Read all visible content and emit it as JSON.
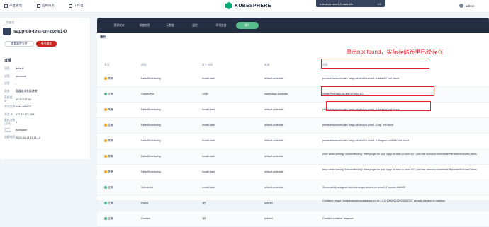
{
  "topbar": {
    "nav": [
      {
        "label": "平台管理",
        "icon": "grid-icon"
      },
      {
        "label": "应用商店",
        "icon": "store-icon"
      },
      {
        "label": "工作台",
        "icon": "workbench-icon"
      }
    ],
    "brand": "KUBESPHERE",
    "popup_title": "b-test-cn-zone1-0-data-file",
    "popup_counter": "1/2",
    "user": "admin"
  },
  "sidebar": {
    "back_label": "容器组",
    "pod_name": "sapp-ob-test-cn-zone1-0",
    "yaml_button": "查看配置文件",
    "more_button": "更多操作",
    "details_title": "详情",
    "details": [
      {
        "key": "项目",
        "value": "default"
      },
      {
        "key": "应用",
        "value": "obcluster"
      },
      {
        "key": "应用",
        "value": "-"
      },
      {
        "key": "状态",
        "value": "容器组未准备就绪"
      },
      {
        "key": "容器组 IP",
        "value": "10.50.112.30"
      },
      {
        "key": "节点名称",
        "value": "ndev-k8s003"
      },
      {
        "key": "节点 IP",
        "value": "172.19.121.198"
      },
      {
        "key": "重启次数(总计)",
        "value": "0"
      },
      {
        "key": "QoS Class",
        "value": "Burstable"
      },
      {
        "key": "创建时间",
        "value": "2023-04-14 16:11:14"
      }
    ]
  },
  "tabs": [
    "资源状态",
    "调度信息",
    "元数据",
    "监控",
    "环境变量",
    "事件"
  ],
  "active_tab": 5,
  "events": {
    "title": "事件",
    "headers": {
      "type": "类型",
      "reason": "原因",
      "time": "发生时间",
      "source": "来源",
      "message": "消息"
    },
    "annotation": "显示not found，实际存储卷里已经存在",
    "rows": [
      {
        "type": "异常",
        "reason": "FailedScheduling",
        "time": "Invalid date",
        "source": "default-scheduler",
        "message": "persistentvolumeclaim \"sapp-ob-test-cn-zone1-0-data-file\" not found"
      },
      {
        "type": "正常",
        "reason": "CreatedPod",
        "time": "1分钟",
        "source": "statefulapp-controller",
        "message": "create Pod sapp-ob-test-cn-zone1-0"
      },
      {
        "type": "异常",
        "reason": "FailedScheduling",
        "time": "Invalid date",
        "source": "default-scheduler",
        "message": "persistentvolumeclaim \"sapp-ob-test-cn-zone1-0-data-log\" not found"
      },
      {
        "type": "异常",
        "reason": "FailedScheduling",
        "time": "Invalid date",
        "source": "default-scheduler",
        "message": "persistentvolumeclaim \"sapp-ob-test-cn-zone1-0-log\" not found"
      },
      {
        "type": "异常",
        "reason": "FailedScheduling",
        "time": "Invalid date",
        "source": "default-scheduler",
        "message": "persistentvolumeclaim \"sapp-ob-test-cn-zone1-0-obagent-conf-file\" not found"
      },
      {
        "type": "异常",
        "reason": "FailedScheduling",
        "time": "Invalid date",
        "source": "default-scheduler",
        "message": "error while running \"VolumeBinding\" filter plugin for pod \"sapp-ob-test-cn-zone1-0\": pod has unbound immediate PersistentVolumeClaims"
      },
      {
        "type": "异常",
        "reason": "FailedScheduling",
        "time": "Invalid date",
        "source": "default-scheduler",
        "message": "error while running \"VolumeBinding\" filter plugin for pod \"sapp-ob-test-cn-zone1-0\": pod has unbound immediate PersistentVolumeClaims"
      },
      {
        "type": "正常",
        "reason": "Scheduled",
        "time": "Invalid date",
        "source": "default-scheduler",
        "message": "Successfully assigned obcluster/sapp-ob-test-cn-zone1-0 to ndev-k8s003"
      },
      {
        "type": "正常",
        "reason": "Pulled",
        "time": "1秒",
        "source": "kubelet",
        "message": "Container image \"oceanbasedev/oceanbase-cn:v4.1.0.0-100000192023032010\" already present on machine"
      },
      {
        "type": "正常",
        "reason": "Created",
        "time": "1秒",
        "source": "kubelet",
        "message": "Created container observer"
      }
    ]
  },
  "colors": {
    "warning": "#f5a623",
    "normal": "#55bc8a",
    "highlight": "#e6232b"
  }
}
